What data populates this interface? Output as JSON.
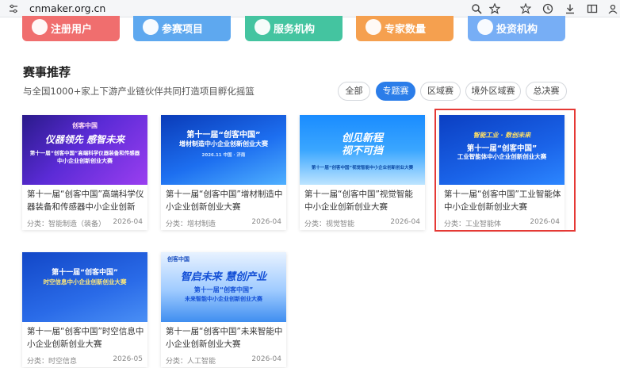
{
  "browser": {
    "url": "cnmaker.org.cn",
    "icons": [
      "tune-icon",
      "zoom-icon",
      "star-icon",
      "extensions-icon",
      "history-icon",
      "download-icon",
      "sidebar-icon",
      "profile-icon"
    ]
  },
  "stats": [
    {
      "label": "注册用户",
      "icon": "user-icon",
      "color": "#f06e6e"
    },
    {
      "label": "参赛项目",
      "icon": "project-icon",
      "color": "#5ea8ef"
    },
    {
      "label": "服务机构",
      "icon": "org-icon",
      "color": "#44c4a0"
    },
    {
      "label": "专家数量",
      "icon": "expert-icon",
      "color": "#f5a04f"
    },
    {
      "label": "投资机构",
      "icon": "invest-icon",
      "color": "#77aef5"
    }
  ],
  "section": {
    "title": "赛事推荐",
    "subtitle": "与全国1000+家上下游产业链伙伴共同打造项目孵化摇篮"
  },
  "filters": [
    "全部",
    "专题赛",
    "区域赛",
    "境外区域赛",
    "总决赛"
  ],
  "active_filter": "专题赛",
  "cards": [
    {
      "title": "第十一届“创客中国”高端科学仪器装备和传感器中小企业创新创...",
      "category": "分类：智能制造（装备）",
      "date": "2026-04",
      "banner": {
        "line1": "仪器领先 感智未来",
        "line2": "第十一届“创客中国”高端科学仪器装备和传感器",
        "line3": "中小企业创新创业大赛",
        "logo": "创客中国"
      }
    },
    {
      "title": "第十一届“创客中国”增材制造中小企业创新创业大赛",
      "category": "分类：增材制造",
      "date": "2026-04",
      "banner": {
        "line1": "第十一届“创客中国”",
        "line2": "增材制造中小企业创新创业大赛",
        "line3": "2026.11  中国 · 济南",
        "logo": ""
      }
    },
    {
      "title": "第十一届“创客中国”视觉智能 中小企业创新创业大赛",
      "category": "分类：视觉智能",
      "date": "2026-04",
      "banner": {
        "line1": "创见新程",
        "line2": "视不可挡",
        "line3": "第十一届“创客中国”视觉智能中小企业创新创业大赛",
        "logo": ""
      }
    },
    {
      "title": "第十一届“创客中国”工业智能体中小企业创新创业大赛",
      "category": "分类：工业智能体",
      "date": "2026-04",
      "banner": {
        "line1": "智能工业 · 数创未来",
        "line2": "第十一届“创客中国”",
        "line3": "工业智能体中小企业创新创业大赛",
        "logo": ""
      }
    },
    {
      "title": "第十一届“创客中国”时空信息中小企业创新创业大赛",
      "category": "分类：时空信息",
      "date": "2026-05",
      "banner": {
        "line1": "第十一届“创客中国”",
        "line2": "时空信息中小企业创新创业大赛",
        "line3": "",
        "logo": ""
      }
    },
    {
      "title": "第十一届“创客中国”未来智能中小企业创新创业大赛",
      "category": "分类：人工智能",
      "date": "2026-04",
      "banner": {
        "line1": "智启未来  慧创产业",
        "line2": "第十一届“创客中国”",
        "line3": "未来智能中小企业创新创业大赛",
        "logo": "创客中国"
      }
    }
  ],
  "colors": {
    "accent": "#2b7de9",
    "highlight": "#e53935"
  }
}
